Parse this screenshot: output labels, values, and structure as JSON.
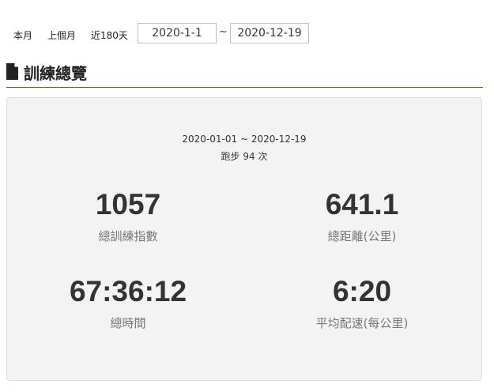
{
  "filters": {
    "this_month": "本月",
    "last_month": "上個月",
    "last_180_days": "近180天",
    "start_date": "2020-1-1",
    "separator": "~",
    "end_date": "2020-12-19"
  },
  "section": {
    "icon": "document-icon",
    "title": "訓練總覽"
  },
  "summary": {
    "date_range": "2020-01-01 ~ 2020-12-19",
    "run_count": "跑步 94 次"
  },
  "stats": {
    "training_index": {
      "value": "1057",
      "label": "總訓練指數"
    },
    "distance": {
      "value": "641.1",
      "label": "總距離(公里)"
    },
    "time": {
      "value": "67:36:12",
      "label": "總時間"
    },
    "pace": {
      "value": "6:20",
      "label": "平均配速(每公里)"
    }
  },
  "colors": {
    "header_rule": "#4a6a28",
    "panel_bg": "#f3f3f3"
  }
}
